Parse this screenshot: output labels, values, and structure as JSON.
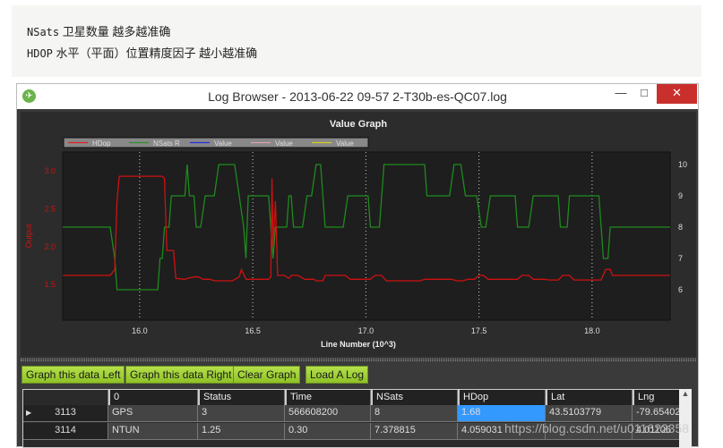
{
  "note": {
    "lines": [
      {
        "key": "NSats",
        "text": "卫星数量 越多越准确"
      },
      {
        "key": "HDOP",
        "text": "水平（平面）位置精度因子 越小越准确"
      }
    ]
  },
  "window": {
    "title": "Log Browser - 2013-06-22 09-57 2-T30b-es-QC07.log",
    "minimize": "—",
    "maximize": "□",
    "close": "✕"
  },
  "chart_data": {
    "type": "line",
    "title": "Value Graph",
    "xlabel": "Line Number (10^3)",
    "ylabel": "Output",
    "xlim": [
      15.66,
      18.345
    ],
    "ylim": [
      1.03,
      3.25
    ],
    "y2lim": [
      5.03,
      10.4
    ],
    "x_ticks": [
      "16.0",
      "16.5",
      "17.0",
      "17.5",
      "18.0"
    ],
    "y_ticks": [
      "1.5",
      "2.0",
      "2.5",
      "3.0"
    ],
    "y2_ticks": [
      "6",
      "7",
      "8",
      "9",
      "10"
    ],
    "grid": "vertical dotted",
    "legend_position": "top-left",
    "legend": [
      {
        "name": "HDop",
        "color": "#e02020"
      },
      {
        "name": "NSats R",
        "color": "#2e8b2e"
      },
      {
        "name": "Value",
        "color": "#2030e0"
      },
      {
        "name": "Value",
        "color": "#e0a0b0"
      },
      {
        "name": "Value",
        "color": "#d0d020"
      }
    ],
    "series": [
      {
        "name": "HDop",
        "axis": "left",
        "color": "#d01010",
        "points": [
          [
            15.66,
            1.62
          ],
          [
            15.87,
            1.62
          ],
          [
            15.89,
            1.7
          ],
          [
            15.9,
            2.6
          ],
          [
            15.91,
            2.93
          ],
          [
            16.1,
            2.93
          ],
          [
            16.11,
            2.9
          ],
          [
            16.12,
            1.95
          ],
          [
            16.15,
            1.95
          ],
          [
            16.16,
            1.58
          ],
          [
            16.2,
            1.57
          ],
          [
            16.21,
            1.58
          ],
          [
            16.24,
            1.6
          ],
          [
            16.26,
            1.6
          ],
          [
            16.28,
            1.57
          ],
          [
            16.31,
            1.57
          ],
          [
            16.33,
            1.55
          ],
          [
            16.41,
            1.55
          ],
          [
            16.44,
            1.6
          ],
          [
            16.45,
            1.7
          ],
          [
            16.47,
            1.57
          ],
          [
            16.57,
            1.57
          ],
          [
            16.58,
            1.6
          ],
          [
            16.585,
            2.9
          ],
          [
            16.59,
            2.0
          ],
          [
            16.6,
            2.6
          ],
          [
            16.61,
            1.62
          ],
          [
            16.64,
            1.62
          ],
          [
            16.66,
            1.58
          ],
          [
            16.67,
            1.62
          ],
          [
            16.7,
            1.62
          ],
          [
            16.73,
            1.57
          ],
          [
            16.77,
            1.57
          ],
          [
            16.78,
            1.55
          ],
          [
            16.81,
            1.55
          ],
          [
            16.82,
            1.62
          ],
          [
            16.91,
            1.62
          ],
          [
            16.93,
            1.57
          ],
          [
            17.02,
            1.57
          ],
          [
            17.04,
            1.62
          ],
          [
            17.07,
            1.62
          ],
          [
            17.09,
            1.55
          ],
          [
            17.24,
            1.55
          ],
          [
            17.26,
            1.57
          ],
          [
            17.38,
            1.57
          ],
          [
            17.4,
            1.55
          ],
          [
            17.43,
            1.55
          ],
          [
            17.45,
            1.57
          ],
          [
            17.48,
            1.57
          ],
          [
            17.5,
            1.62
          ],
          [
            17.52,
            1.62
          ],
          [
            17.54,
            1.57
          ],
          [
            17.67,
            1.57
          ],
          [
            17.69,
            1.62
          ],
          [
            17.72,
            1.62
          ],
          [
            17.74,
            1.57
          ],
          [
            17.79,
            1.57
          ],
          [
            17.81,
            1.56
          ],
          [
            17.85,
            1.56
          ],
          [
            17.87,
            1.62
          ],
          [
            17.9,
            1.62
          ],
          [
            17.92,
            1.56
          ],
          [
            18.04,
            1.56
          ],
          [
            18.06,
            1.7
          ],
          [
            18.08,
            1.7
          ],
          [
            18.09,
            1.62
          ],
          [
            18.345,
            1.62
          ]
        ]
      },
      {
        "name": "NSats R",
        "axis": "right",
        "color": "#1f8a1f",
        "points": [
          [
            15.66,
            8
          ],
          [
            15.87,
            8
          ],
          [
            15.89,
            7
          ],
          [
            15.9,
            6
          ],
          [
            16.08,
            6
          ],
          [
            16.09,
            7
          ],
          [
            16.1,
            7
          ],
          [
            16.11,
            8
          ],
          [
            16.13,
            8
          ],
          [
            16.14,
            9
          ],
          [
            16.2,
            9
          ],
          [
            16.21,
            10
          ],
          [
            16.22,
            9
          ],
          [
            16.24,
            9
          ],
          [
            16.25,
            8
          ],
          [
            16.27,
            8
          ],
          [
            16.29,
            9
          ],
          [
            16.33,
            9
          ],
          [
            16.35,
            10
          ],
          [
            16.42,
            10
          ],
          [
            16.44,
            9
          ],
          [
            16.46,
            8
          ],
          [
            16.47,
            7
          ],
          [
            16.48,
            9
          ],
          [
            16.57,
            9
          ],
          [
            16.59,
            7
          ],
          [
            16.6,
            8
          ],
          [
            16.65,
            8
          ],
          [
            16.66,
            9
          ],
          [
            16.67,
            9
          ],
          [
            16.68,
            8
          ],
          [
            16.72,
            8
          ],
          [
            16.74,
            9
          ],
          [
            16.76,
            9
          ],
          [
            16.78,
            10
          ],
          [
            16.8,
            10
          ],
          [
            16.81,
            9
          ],
          [
            16.82,
            8
          ],
          [
            16.9,
            8
          ],
          [
            16.92,
            9
          ],
          [
            17.01,
            9
          ],
          [
            17.02,
            8
          ],
          [
            17.06,
            8
          ],
          [
            17.08,
            10
          ],
          [
            17.26,
            10
          ],
          [
            17.27,
            9
          ],
          [
            17.37,
            9
          ],
          [
            17.39,
            10
          ],
          [
            17.42,
            10
          ],
          [
            17.44,
            9
          ],
          [
            17.49,
            9
          ],
          [
            17.51,
            8
          ],
          [
            17.53,
            8
          ],
          [
            17.55,
            9
          ],
          [
            17.66,
            9
          ],
          [
            17.67,
            8
          ],
          [
            17.72,
            8
          ],
          [
            17.74,
            9
          ],
          [
            17.85,
            9
          ],
          [
            17.86,
            8
          ],
          [
            17.89,
            8
          ],
          [
            17.9,
            9
          ],
          [
            18.03,
            9
          ],
          [
            18.05,
            7
          ],
          [
            18.07,
            7
          ],
          [
            18.08,
            8
          ],
          [
            18.345,
            8
          ]
        ]
      }
    ]
  },
  "buttons": {
    "graph_left": "Graph this data Left",
    "graph_right": "Graph this data Right",
    "clear": "Clear Graph",
    "load": "Load A Log"
  },
  "table": {
    "headers": [
      "",
      "0",
      "Status",
      "Time",
      "NSats",
      "HDop",
      "Lat",
      "Lng"
    ],
    "rows": [
      [
        "3113",
        "GPS",
        "3",
        "566608200",
        "8",
        "1.68",
        "43.5103779",
        "-79.65402"
      ],
      [
        "3114",
        "NTUN",
        "1.25",
        "0.30",
        "7.378815",
        "4.059031",
        "",
        "4.01106"
      ]
    ],
    "selected_cell": "1.68"
  },
  "scroll_up": "▲",
  "watermark": "https://blog.csdn.net/u011622358"
}
